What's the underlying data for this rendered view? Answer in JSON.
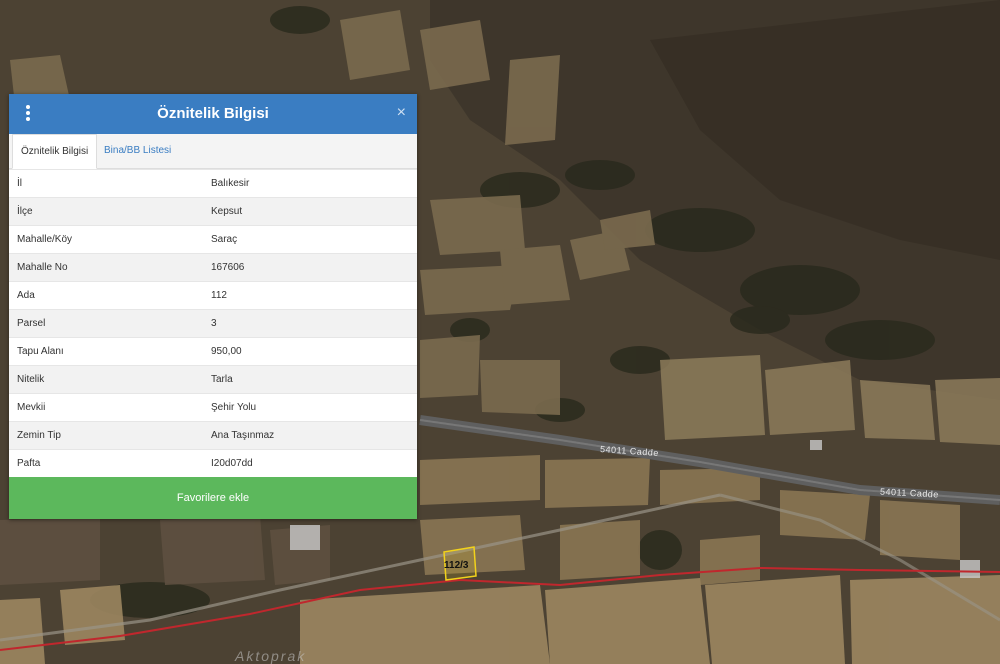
{
  "panel": {
    "title": "Öznitelik Bilgisi",
    "close_symbol": "×",
    "menu_icon": "vertical-dots-icon",
    "tabs": [
      {
        "label": "Öznitelik Bilgisi",
        "active": true
      },
      {
        "label": "Bina/BB Listesi",
        "active": false
      }
    ],
    "rows": [
      {
        "key": "İl",
        "value": "Balıkesir"
      },
      {
        "key": "İlçe",
        "value": "Kepsut"
      },
      {
        "key": "Mahalle/Köy",
        "value": "Saraç"
      },
      {
        "key": "Mahalle No",
        "value": "167606"
      },
      {
        "key": "Ada",
        "value": "112"
      },
      {
        "key": "Parsel",
        "value": "3"
      },
      {
        "key": "Tapu Alanı",
        "value": "950,00"
      },
      {
        "key": "Nitelik",
        "value": "Tarla"
      },
      {
        "key": "Mevkii",
        "value": "Şehir Yolu"
      },
      {
        "key": "Zemin Tip",
        "value": "Ana Taşınmaz"
      },
      {
        "key": "Pafta",
        "value": "I20d07dd"
      }
    ],
    "favorite_button": "Favorilere ekle",
    "colors": {
      "header": "#3a7dc2",
      "button": "#5cb85c"
    }
  },
  "map": {
    "road_labels": [
      "54011 Cadde",
      "54011 Cadde"
    ],
    "parcel_label": "112/3",
    "place_label": "Aktoprak",
    "colors": {
      "boundary_line": "#c0272d",
      "parcel_outline": "#f2d21b",
      "road": "#6c6c6c"
    }
  }
}
